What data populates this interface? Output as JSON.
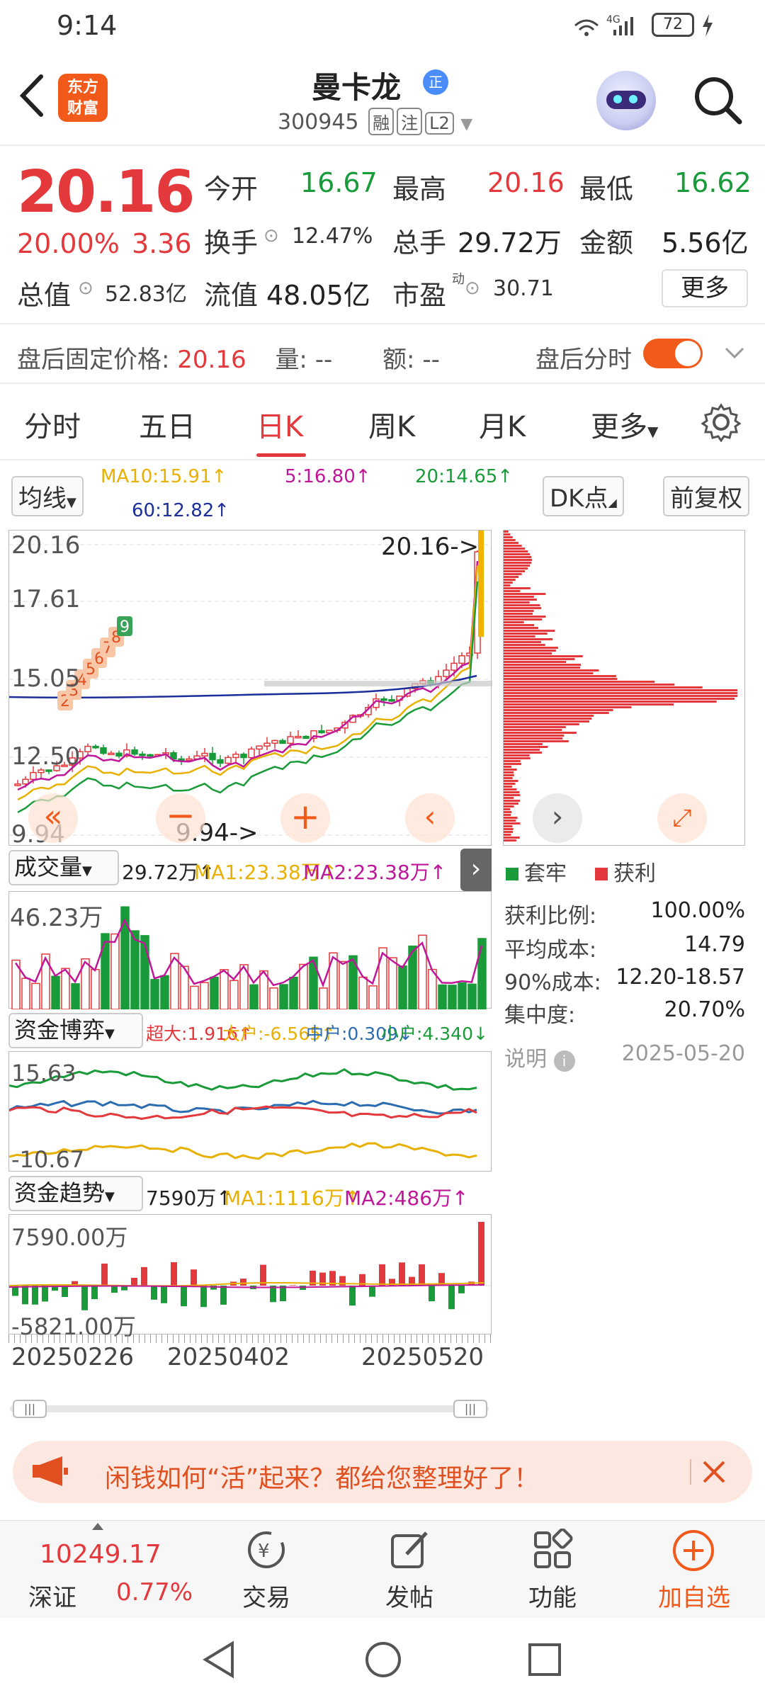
{
  "status": {
    "time": "9:14",
    "network": "4G",
    "battery": "72"
  },
  "header": {
    "name": "曼卡龙",
    "code": "300945",
    "tags": [
      "融",
      "注",
      "L2"
    ],
    "logo": "东方\n财富",
    "verified": "正"
  },
  "quote": {
    "price": "20.16",
    "pct": "20.00%",
    "chg": "3.36",
    "open_label": "今开",
    "open": "16.67",
    "high_label": "最高",
    "high": "20.16",
    "low_label": "最低",
    "low": "16.62",
    "turnover_label": "换手",
    "turnover": "12.47%",
    "vol_label": "总手",
    "vol": "29.72万",
    "amount_label": "金额",
    "amount": "5.56亿",
    "mcap_label": "总值",
    "mcap": "52.83亿",
    "float_label": "流值",
    "float": "48.05亿",
    "pe_label": "市盈",
    "pe_sup": "动",
    "pe": "30.71",
    "more": "更多"
  },
  "after_hours": {
    "label": "盘后固定价格:",
    "price": "20.16",
    "vol_label": "量: --",
    "amt_label": "额: --",
    "timeshare": "盘后分时"
  },
  "period_tabs": [
    "分时",
    "五日",
    "日K",
    "周K",
    "月K",
    "更多"
  ],
  "ma_bar": {
    "select": "均线",
    "ma10": "MA10:15.91↑",
    "ma5": "5:16.80↑",
    "ma20": "20:14.65↑",
    "ma60": "60:12.82↑",
    "dk": "DK点",
    "adjust": "前复权"
  },
  "kline": {
    "y_labels": [
      "20.16",
      "17.61",
      "15.05",
      "12.50",
      "9.94"
    ],
    "hi_marker": "20.16->",
    "lo_marker": "9.94->",
    "tz_labels": [
      "2",
      "3",
      "4",
      "5",
      "6",
      "7",
      "8",
      "9"
    ]
  },
  "chip": {
    "legend_trap": "套牢",
    "legend_profit": "获利",
    "rows": [
      {
        "label": "获利比例:",
        "value": "100.00%"
      },
      {
        "label": "平均成本:",
        "value": "14.79"
      },
      {
        "label": "90%成本:",
        "value": "12.20-18.57"
      },
      {
        "label": "集中度:",
        "value": "20.70%"
      }
    ],
    "note": "说明",
    "date": "2025-05-20"
  },
  "volume": {
    "select": "成交量",
    "v": "29.72万↑",
    "ma1": "MA1:23.38万↑",
    "ma2": "MA2:23.38万↑",
    "top": "46.23万"
  },
  "fund_game": {
    "select": "资金博弈",
    "super": "超大:1.916↑",
    "big": "大户:-6.565↑",
    "mid": "中户:0.309↓",
    "small": "小户:4.340↓",
    "top": "15.63",
    "bottom": "-10.67"
  },
  "fund_trend": {
    "select": "资金趋势",
    "v": "7590万↑",
    "ma1": "MA1:1116万↑",
    "ma2": "MA2:486万↑",
    "top": "7590.00万",
    "bottom": "-5821.00万"
  },
  "dates": [
    "20250226",
    "20250402",
    "20250520"
  ],
  "banner": {
    "text": "闲钱如何“活”起来？都给您整理好了！"
  },
  "bottom_nav": {
    "index_value": "10249.17",
    "index_name": "深证",
    "index_pct": "0.77%",
    "trade": "交易",
    "post": "发帖",
    "func": "功能",
    "add": "加自选"
  },
  "colors": {
    "up": "#e4393c",
    "down": "#1a9b3a",
    "accent": "#f25a1c"
  }
}
